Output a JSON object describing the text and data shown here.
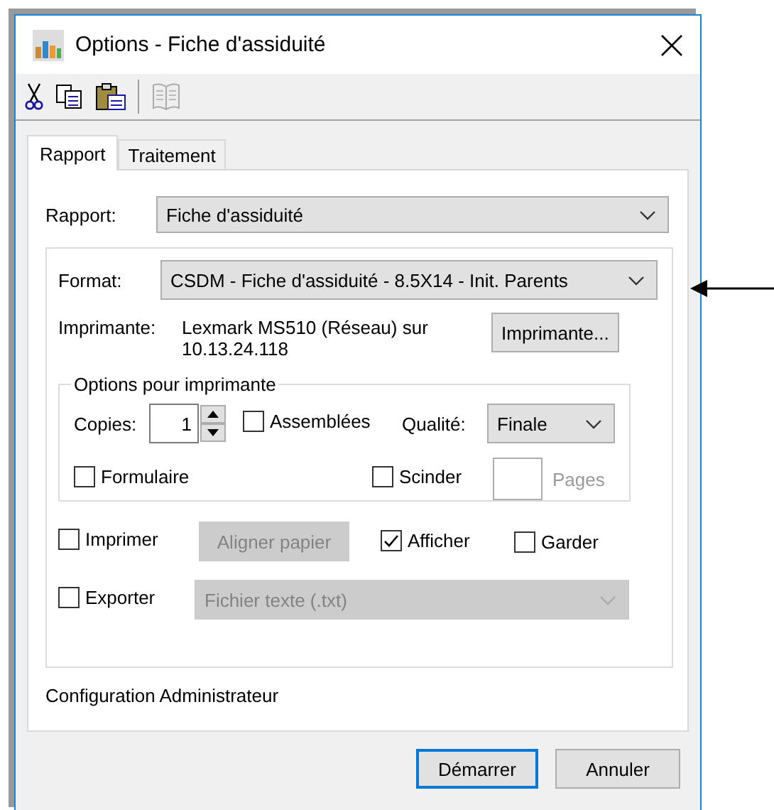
{
  "window": {
    "title": "Options - Fiche d'assiduité"
  },
  "toolbar": [
    {
      "kind": "cut",
      "disabled": false
    },
    {
      "kind": "copy",
      "disabled": false
    },
    {
      "kind": "paste",
      "disabled": false
    },
    {
      "kind": "separator"
    },
    {
      "kind": "book",
      "disabled": true
    }
  ],
  "tabs": [
    {
      "label": "Rapport",
      "selected": true
    },
    {
      "label": "Traitement",
      "selected": false
    }
  ],
  "rapport": {
    "label": "Rapport:",
    "value": "Fiche d'assiduité"
  },
  "format": {
    "label": "Format:",
    "value": "CSDM - Fiche d'assiduité - 8.5X14 - Init. Parents"
  },
  "printer": {
    "label": "Imprimante:",
    "value_lines": [
      "Lexmark MS510 (Réseau) sur",
      "10.13.24.118"
    ],
    "button": "Imprimante..."
  },
  "printer_options": {
    "title": "Options pour imprimante",
    "copies": {
      "label": "Copies:",
      "value": "1"
    },
    "assemblees": {
      "label": "Assemblées",
      "checked": false
    },
    "quality": {
      "label": "Qualité:",
      "value": "Finale"
    },
    "formulaire": {
      "label": "Formulaire",
      "checked": false
    },
    "scinder": {
      "label": "Scinder",
      "checked": false
    },
    "pages": {
      "label": "Pages",
      "disabled": true
    }
  },
  "output": {
    "imprimer": {
      "label": "Imprimer",
      "checked": false
    },
    "align_button": {
      "label": "Aligner papier",
      "disabled": true
    },
    "afficher": {
      "label": "Afficher",
      "checked": true
    },
    "garder": {
      "label": "Garder",
      "checked": false
    },
    "exporter": {
      "label": "Exporter",
      "checked": false
    },
    "export_format": {
      "value": "Fichier texte (.txt)",
      "disabled": true
    }
  },
  "footer_text": "Configuration Administrateur",
  "buttons": [
    {
      "label": "Démarrer",
      "default": true
    },
    {
      "label": "Annuler",
      "default": false
    }
  ]
}
